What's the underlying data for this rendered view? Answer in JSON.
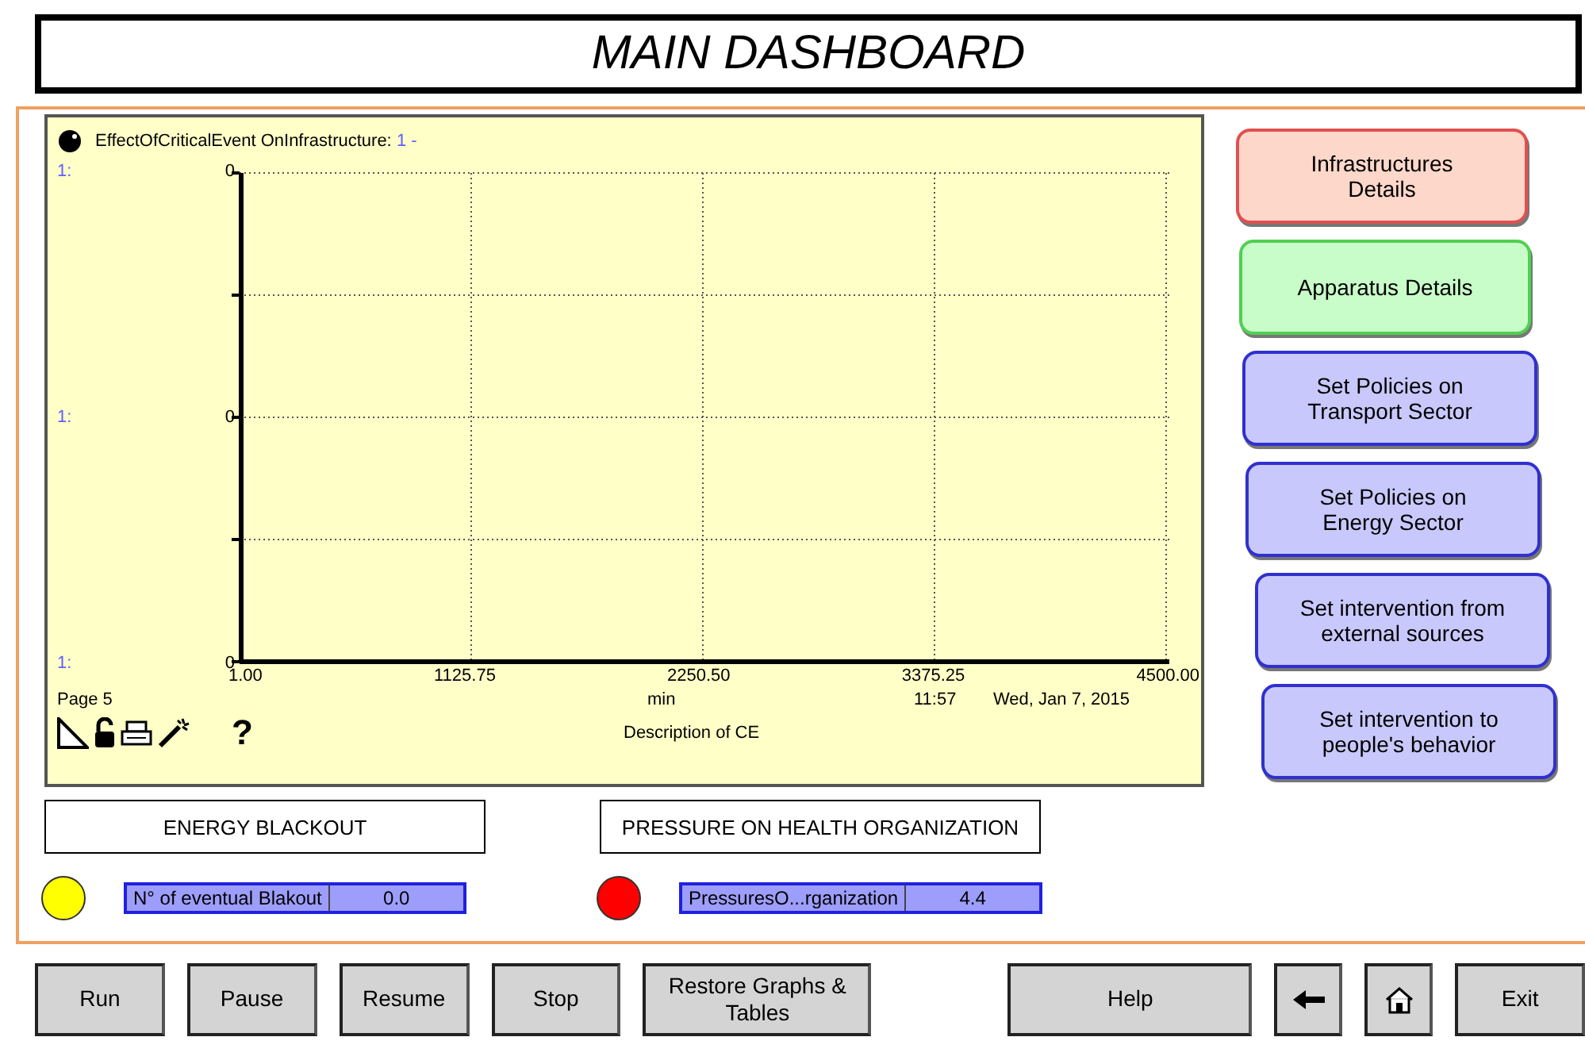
{
  "title": "MAIN DASHBOARD",
  "chart": {
    "legend": "EffectOfCriticalEvent OnInfrastructure:",
    "legend_series": "1 -",
    "scale_labels": [
      "1:",
      "1:",
      "1:"
    ],
    "y_ticks": [
      "0",
      "0",
      "0"
    ],
    "x_ticks": [
      "1.00",
      "1125.75",
      "2250.50",
      "3375.25",
      "4500.00"
    ],
    "page": "Page 5",
    "x_unit": "min",
    "time": "11:57",
    "date": "Wed, Jan 7, 2015",
    "description": "Description of CE",
    "help": "?"
  },
  "indicators": [
    {
      "title": "ENERGY BLACKOUT",
      "label": "N° of eventual  Blakout",
      "value": "0.0",
      "color": "#ffff00"
    },
    {
      "title": "PRESSURE ON HEALTH ORGANIZATION",
      "label": "PressuresO...rganization",
      "value": "4.4",
      "color": "#ff0000"
    }
  ],
  "side_buttons": [
    {
      "label": "Infrastructures Details",
      "kind": "red"
    },
    {
      "label": "Apparatus Details",
      "kind": "green"
    },
    {
      "label": "Set Policies on Transport Sector",
      "kind": "blue"
    },
    {
      "label": "Set Policies on Energy Sector",
      "kind": "blue"
    },
    {
      "label": "Set intervention from external sources",
      "kind": "blue"
    },
    {
      "label": "Set intervention to people's behavior",
      "kind": "blue"
    }
  ],
  "controls": [
    "Run",
    "Pause",
    "Resume",
    "Stop",
    "Restore Graphs & Tables"
  ],
  "help_button": "Help",
  "exit_button": "Exit"
}
